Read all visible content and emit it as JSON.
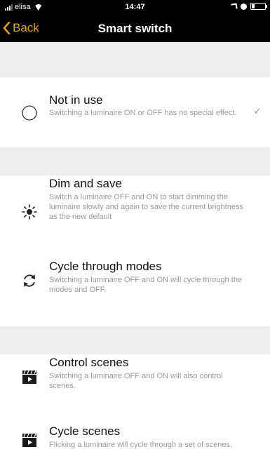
{
  "status": {
    "carrier": "elisa",
    "time": "14:47"
  },
  "nav": {
    "back_label": "Back",
    "title": "Smart switch"
  },
  "options": [
    {
      "title": "Not in use",
      "desc": "Switching a luminaire ON or OFF has no special effect.",
      "icon": "circle-icon",
      "selected": true
    },
    {
      "title": "Dim and save",
      "desc": "Switch a luminaire OFF and ON to start dimming the luminaire slowly and again to save the current brightness as the new default",
      "icon": "brightness-icon",
      "selected": false
    },
    {
      "title": "Cycle through modes",
      "desc": "Switching a luminaire OFF and ON will cycle through the modes and OFF.",
      "icon": "cycle-icon",
      "selected": false
    },
    {
      "title": "Control scenes",
      "desc": "Switching a luminaire OFF and ON will also control scenes.",
      "icon": "scene-clapper-icon",
      "selected": false
    },
    {
      "title": "Cycle scenes",
      "desc": "Flicking a luminaire will cycle through a set of scenes.",
      "icon": "scene-clapper-icon",
      "selected": false
    }
  ],
  "colors": {
    "accent": "#e0a020",
    "separator": "#ededed",
    "secondary_text": "#9a9a9a"
  }
}
